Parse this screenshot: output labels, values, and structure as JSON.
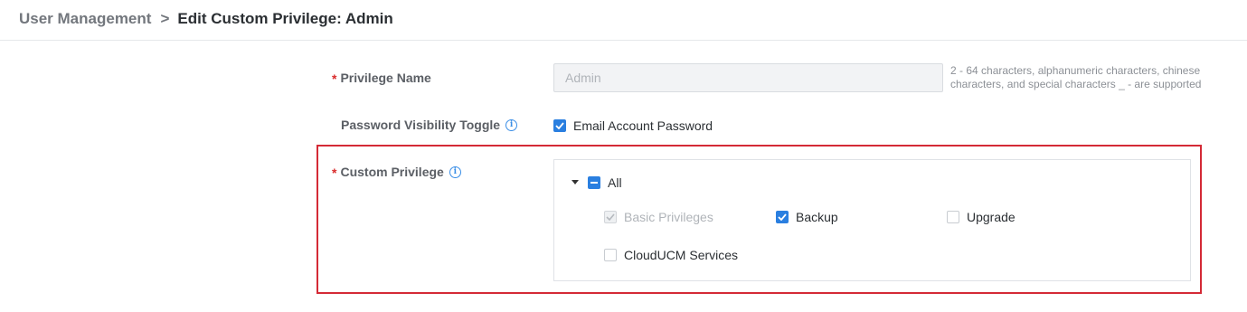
{
  "breadcrumb": {
    "parent": "User Management",
    "separator": ">",
    "current": "Edit Custom Privilege: Admin"
  },
  "form": {
    "privilege_name": {
      "required_mark": "*",
      "label": "Privilege Name",
      "value": "Admin",
      "hint": "2 - 64 characters, alphanumeric characters, chinese characters, and special characters _ - are supported"
    },
    "password_visibility": {
      "label": "Password Visibility Toggle",
      "info_icon": "info-icon",
      "option": {
        "label": "Email Account Password",
        "checked": true
      }
    },
    "custom_privilege": {
      "required_mark": "*",
      "label": "Custom Privilege",
      "info_icon": "info-icon",
      "tree": {
        "root": {
          "label": "All",
          "state": "indeterminate",
          "expanded": true
        },
        "children": [
          {
            "label": "Basic Privileges",
            "checked": true,
            "disabled": true
          },
          {
            "label": "Backup",
            "checked": true,
            "disabled": false
          },
          {
            "label": "Upgrade",
            "checked": false,
            "disabled": false
          },
          {
            "label": "CloudUCM Services",
            "checked": false,
            "disabled": false
          }
        ]
      }
    }
  },
  "colors": {
    "accent": "#2a7fe0",
    "required": "#d92b2b",
    "highlight_border": "#d42a36"
  }
}
